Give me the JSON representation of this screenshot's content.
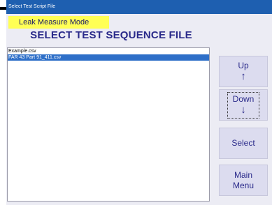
{
  "window": {
    "title": "Select Test Script File"
  },
  "mode": "Leak Measure Mode",
  "heading": "SELECT TEST SEQUENCE FILE",
  "files": [
    {
      "name": "Example.csv",
      "selected": false
    },
    {
      "name": "FAR 43 Part 91_411.csv",
      "selected": true
    }
  ],
  "buttons": {
    "up": {
      "label": "Up",
      "icon": "arrow-up-icon"
    },
    "down": {
      "label": "Down",
      "icon": "arrow-down-icon"
    },
    "select": {
      "label": "Select"
    },
    "main_menu": {
      "line1": "Main",
      "line2": "Menu"
    }
  },
  "colors": {
    "titlebar": "#1e5fb0",
    "mode_badge": "#ffff55",
    "heading_text": "#2a2a8a",
    "selection": "#2e6fc8",
    "button_face": "#dcdcef"
  }
}
